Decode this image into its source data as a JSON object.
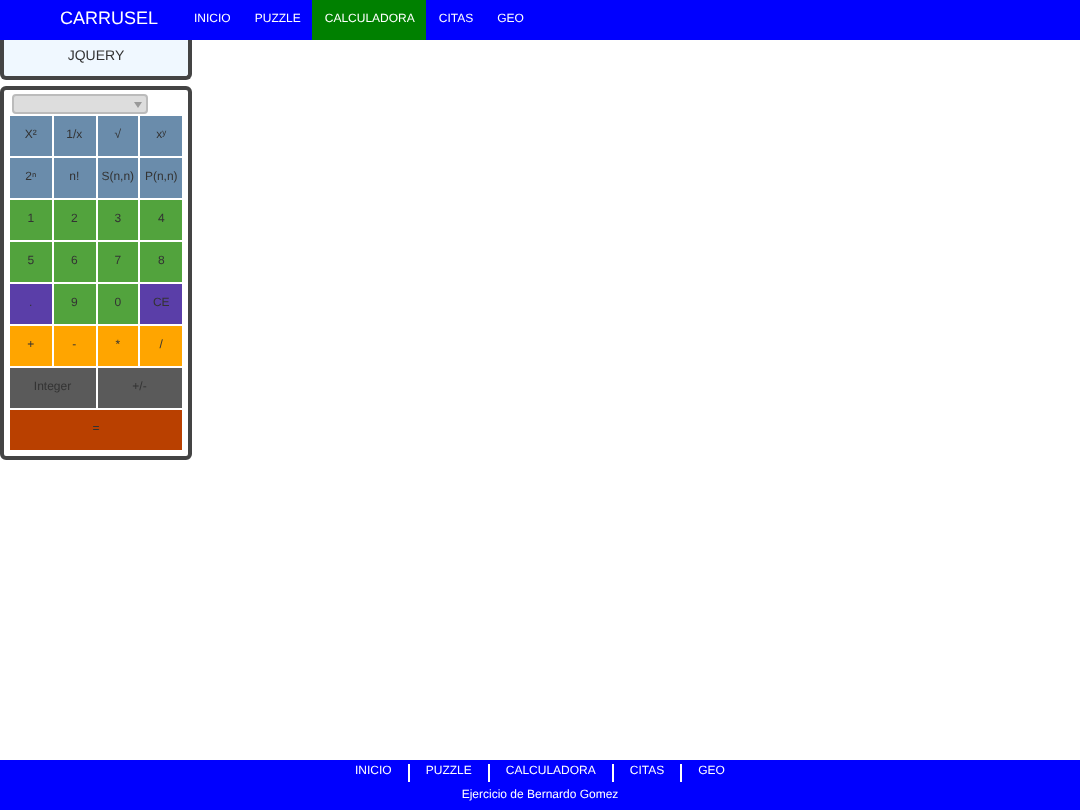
{
  "navbar": {
    "brand": "CARRUSEL",
    "items": [
      {
        "label": "INICIO",
        "selected": false
      },
      {
        "label": "PUZZLE",
        "selected": false
      },
      {
        "label": "CALCULADORA",
        "selected": true
      },
      {
        "label": "CITAS",
        "selected": false
      },
      {
        "label": "GEO",
        "selected": false
      }
    ]
  },
  "side_button": "JQUERY",
  "calculator": {
    "keys": [
      {
        "label": "X²",
        "kind": "fn"
      },
      {
        "label": "1/x",
        "kind": "fn"
      },
      {
        "label": "√",
        "kind": "fn"
      },
      {
        "label": "xʸ",
        "kind": "fn"
      },
      {
        "label": "2ⁿ",
        "kind": "fn"
      },
      {
        "label": "n!",
        "kind": "fn"
      },
      {
        "label": "S(n,n)",
        "kind": "fn"
      },
      {
        "label": "P(n,n)",
        "kind": "fn"
      },
      {
        "label": "1",
        "kind": "num"
      },
      {
        "label": "2",
        "kind": "num"
      },
      {
        "label": "3",
        "kind": "num"
      },
      {
        "label": "4",
        "kind": "num"
      },
      {
        "label": "5",
        "kind": "num"
      },
      {
        "label": "6",
        "kind": "num"
      },
      {
        "label": "7",
        "kind": "num"
      },
      {
        "label": "8",
        "kind": "num"
      },
      {
        "label": ".",
        "kind": "special"
      },
      {
        "label": "9",
        "kind": "num"
      },
      {
        "label": "0",
        "kind": "num"
      },
      {
        "label": "CE",
        "kind": "special"
      },
      {
        "label": "+",
        "kind": "op"
      },
      {
        "label": "-",
        "kind": "op"
      },
      {
        "label": "*",
        "kind": "op"
      },
      {
        "label": "/",
        "kind": "op"
      },
      {
        "label": "Integer",
        "kind": "misc"
      },
      {
        "label": "+/-",
        "kind": "misc"
      },
      {
        "label": "=",
        "kind": "equals"
      }
    ]
  },
  "footer": {
    "links": [
      "INICIO",
      "PUZZLE",
      "CALCULADORA",
      "CITAS",
      "GEO"
    ],
    "credit": "Ejercicio de Bernardo Gomez"
  }
}
